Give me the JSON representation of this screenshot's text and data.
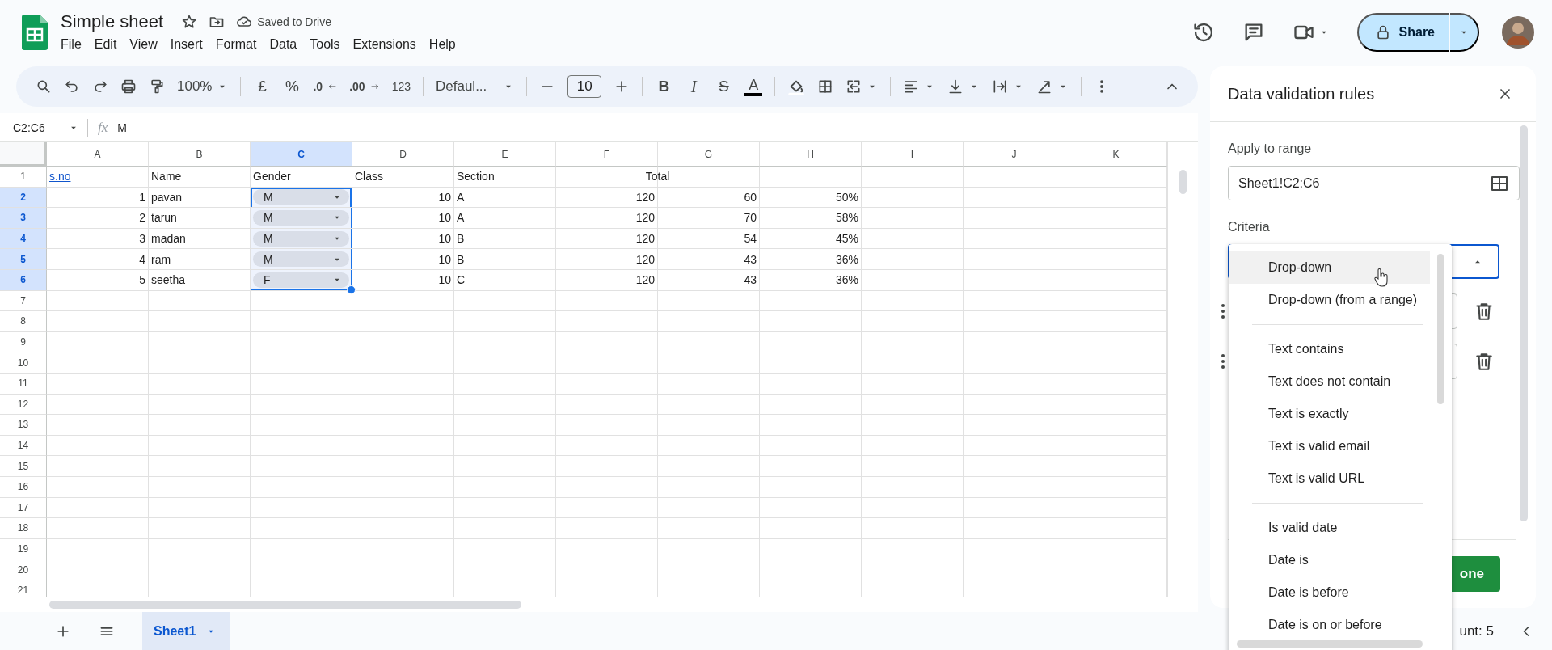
{
  "app": {
    "title": "Simple sheet",
    "save_status": "Saved to Drive",
    "menu": [
      "File",
      "Edit",
      "View",
      "Insert",
      "Format",
      "Data",
      "Tools",
      "Extensions",
      "Help"
    ],
    "share": "Share"
  },
  "toolbar": {
    "zoom": "100%",
    "currency": "£",
    "percent": "%",
    "decrease_decimal": ".0",
    "increase_decimal": ".00",
    "number_format": "123",
    "font": "Defaul...",
    "font_size": "10",
    "bold": "B",
    "italic": "I",
    "strikethrough": "S",
    "text_color": "A"
  },
  "formula_bar": {
    "name_box": "C2:C6",
    "fx": "fx",
    "value": "M"
  },
  "grid": {
    "columns": [
      {
        "label": "A",
        "selected": false
      },
      {
        "label": "B",
        "selected": false
      },
      {
        "label": "C",
        "selected": true
      },
      {
        "label": "D",
        "selected": false
      },
      {
        "label": "E",
        "selected": false
      },
      {
        "label": "F",
        "selected": false
      },
      {
        "label": "G",
        "selected": false
      },
      {
        "label": "H",
        "selected": false
      },
      {
        "label": "I",
        "selected": false
      },
      {
        "label": "J",
        "selected": false
      },
      {
        "label": "K",
        "selected": false
      }
    ],
    "rows": [
      {
        "number": "1",
        "selected": false,
        "cells": [
          {
            "kind": "link",
            "text": "s.no"
          },
          {
            "kind": "text",
            "text": "Name"
          },
          {
            "kind": "text",
            "text": "Gender"
          },
          {
            "kind": "text",
            "text": "Class"
          },
          {
            "kind": "text",
            "text": "Section"
          },
          {
            "kind": "merged",
            "text": "Total"
          }
        ]
      },
      {
        "number": "2",
        "selected": true,
        "cells": [
          {
            "kind": "number",
            "text": "1"
          },
          {
            "kind": "text",
            "text": "pavan"
          },
          {
            "kind": "chip",
            "text": "M"
          },
          {
            "kind": "number",
            "text": "10"
          },
          {
            "kind": "text",
            "text": "A"
          },
          {
            "kind": "number",
            "text": "120"
          },
          {
            "kind": "number",
            "text": "60"
          },
          {
            "kind": "number",
            "text": "50%"
          }
        ]
      },
      {
        "number": "3",
        "selected": true,
        "cells": [
          {
            "kind": "number",
            "text": "2"
          },
          {
            "kind": "text",
            "text": "tarun"
          },
          {
            "kind": "chip",
            "text": "M"
          },
          {
            "kind": "number",
            "text": "10"
          },
          {
            "kind": "text",
            "text": "A"
          },
          {
            "kind": "number",
            "text": "120"
          },
          {
            "kind": "number",
            "text": "70"
          },
          {
            "kind": "number",
            "text": "58%"
          }
        ]
      },
      {
        "number": "4",
        "selected": true,
        "cells": [
          {
            "kind": "number",
            "text": "3"
          },
          {
            "kind": "text",
            "text": "madan"
          },
          {
            "kind": "chip",
            "text": "M"
          },
          {
            "kind": "number",
            "text": "10"
          },
          {
            "kind": "text",
            "text": "B"
          },
          {
            "kind": "number",
            "text": "120"
          },
          {
            "kind": "number",
            "text": "54"
          },
          {
            "kind": "number",
            "text": "45%"
          }
        ]
      },
      {
        "number": "5",
        "selected": true,
        "cells": [
          {
            "kind": "number",
            "text": "4"
          },
          {
            "kind": "text",
            "text": "ram"
          },
          {
            "kind": "chip",
            "text": "M"
          },
          {
            "kind": "number",
            "text": "10"
          },
          {
            "kind": "text",
            "text": "B"
          },
          {
            "kind": "number",
            "text": "120"
          },
          {
            "kind": "number",
            "text": "43"
          },
          {
            "kind": "number",
            "text": "36%"
          }
        ]
      },
      {
        "number": "6",
        "selected": true,
        "cells": [
          {
            "kind": "number",
            "text": "5"
          },
          {
            "kind": "text",
            "text": "seetha"
          },
          {
            "kind": "chip",
            "text": "F"
          },
          {
            "kind": "number",
            "text": "10"
          },
          {
            "kind": "text",
            "text": "C"
          },
          {
            "kind": "number",
            "text": "120"
          },
          {
            "kind": "number",
            "text": "43"
          },
          {
            "kind": "number",
            "text": "36%"
          }
        ]
      },
      {
        "number": "7",
        "selected": false,
        "cells": []
      },
      {
        "number": "8",
        "selected": false,
        "cells": []
      },
      {
        "number": "9",
        "selected": false,
        "cells": []
      },
      {
        "number": "10",
        "selected": false,
        "cells": []
      },
      {
        "number": "11",
        "selected": false,
        "cells": []
      },
      {
        "number": "12",
        "selected": false,
        "cells": []
      },
      {
        "number": "13",
        "selected": false,
        "cells": []
      },
      {
        "number": "14",
        "selected": false,
        "cells": []
      },
      {
        "number": "15",
        "selected": false,
        "cells": []
      },
      {
        "number": "16",
        "selected": false,
        "cells": []
      },
      {
        "number": "17",
        "selected": false,
        "cells": []
      },
      {
        "number": "18",
        "selected": false,
        "cells": []
      },
      {
        "number": "19",
        "selected": false,
        "cells": []
      },
      {
        "number": "20",
        "selected": false,
        "cells": []
      },
      {
        "number": "21",
        "selected": false,
        "cells": []
      }
    ]
  },
  "sheet_tabs": [
    {
      "label": "Sheet1",
      "selected": true
    }
  ],
  "status": "unt: 5",
  "panel": {
    "title": "Data validation rules",
    "apply_label": "Apply to range",
    "range": "Sheet1!C2:C6",
    "criteria_label": "Criteria",
    "done": "one"
  },
  "criteria_menu": {
    "groups": [
      {
        "items": [
          {
            "label": "Drop-down",
            "selected": true
          },
          {
            "label": "Drop-down (from a range)",
            "selected": false
          }
        ]
      },
      {
        "items": [
          {
            "label": "Text contains",
            "selected": false
          },
          {
            "label": "Text does not contain",
            "selected": false
          },
          {
            "label": "Text is exactly",
            "selected": false
          },
          {
            "label": "Text is valid email",
            "selected": false
          },
          {
            "label": "Text is valid URL",
            "selected": false
          }
        ]
      },
      {
        "items": [
          {
            "label": "Is valid date",
            "selected": false
          },
          {
            "label": "Date is",
            "selected": false
          },
          {
            "label": "Date is before",
            "selected": false
          },
          {
            "label": "Date is on or before",
            "selected": false
          }
        ]
      }
    ]
  }
}
